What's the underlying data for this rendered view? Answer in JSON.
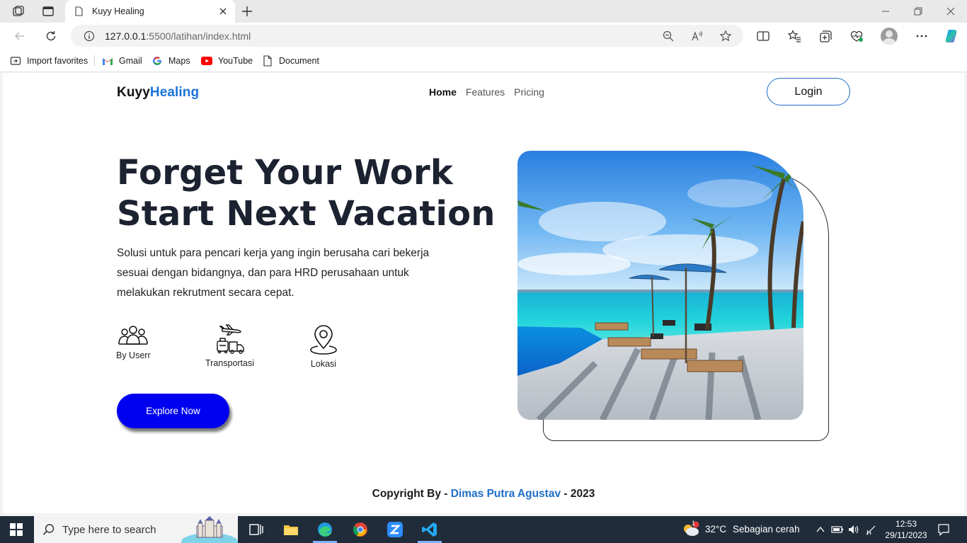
{
  "browser": {
    "tab_title": "Kuyy Healing",
    "url_host": "127.0.0.1",
    "url_path": ":5500/latihan/index.html",
    "favorites": [
      {
        "label": "Import favorites",
        "icon": "import-icon"
      },
      {
        "label": "Gmail",
        "icon": "gmail-icon"
      },
      {
        "label": "Maps",
        "icon": "google-icon"
      },
      {
        "label": "YouTube",
        "icon": "youtube-icon"
      },
      {
        "label": "Document",
        "icon": "document-icon"
      }
    ]
  },
  "site": {
    "brand_part1": "Kuyy",
    "brand_part2": "Healing",
    "nav": {
      "home": "Home",
      "features": "Features",
      "pricing": "Pricing"
    },
    "login_label": "Login",
    "hero": {
      "title_line1": "Forget Your Work",
      "title_line2": "Start Next Vacation",
      "description": "Solusi untuk para pencari kerja yang ingin berusaha cari bekerja sesuai dengan bidangnya, dan para HRD perusahaan untuk melakukan rekrutment secara cepat."
    },
    "features": [
      {
        "label": "By Userr",
        "icon": "users-icon"
      },
      {
        "label": "Transportasi",
        "icon": "transport-icon"
      },
      {
        "label": "Lokasi",
        "icon": "location-pin-icon"
      }
    ],
    "cta_label": "Explore Now",
    "footer": {
      "prefix": "Copyright By - ",
      "name": "Dimas Putra Agustav",
      "suffix": " - 2023"
    }
  },
  "taskbar": {
    "search_placeholder": "Type here to search",
    "weather_temp": "32°C",
    "weather_desc": "Sebagian cerah",
    "weather_badge": "1",
    "time": "12:53",
    "date": "29/11/2023"
  },
  "colors": {
    "brand_accent": "#1a73d9",
    "cta": "#0000f0",
    "title": "#1c2230"
  }
}
